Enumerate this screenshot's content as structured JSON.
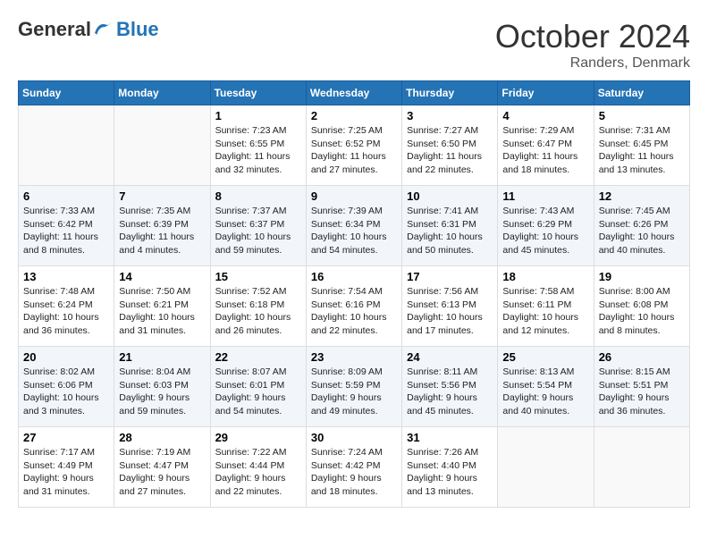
{
  "logo": {
    "general": "General",
    "blue": "Blue"
  },
  "header": {
    "month": "October 2024",
    "location": "Randers, Denmark"
  },
  "weekdays": [
    "Sunday",
    "Monday",
    "Tuesday",
    "Wednesday",
    "Thursday",
    "Friday",
    "Saturday"
  ],
  "weeks": [
    [
      {
        "day": "",
        "empty": true
      },
      {
        "day": "",
        "empty": true
      },
      {
        "day": "1",
        "line1": "Sunrise: 7:23 AM",
        "line2": "Sunset: 6:55 PM",
        "line3": "Daylight: 11 hours",
        "line4": "and 32 minutes."
      },
      {
        "day": "2",
        "line1": "Sunrise: 7:25 AM",
        "line2": "Sunset: 6:52 PM",
        "line3": "Daylight: 11 hours",
        "line4": "and 27 minutes."
      },
      {
        "day": "3",
        "line1": "Sunrise: 7:27 AM",
        "line2": "Sunset: 6:50 PM",
        "line3": "Daylight: 11 hours",
        "line4": "and 22 minutes."
      },
      {
        "day": "4",
        "line1": "Sunrise: 7:29 AM",
        "line2": "Sunset: 6:47 PM",
        "line3": "Daylight: 11 hours",
        "line4": "and 18 minutes."
      },
      {
        "day": "5",
        "line1": "Sunrise: 7:31 AM",
        "line2": "Sunset: 6:45 PM",
        "line3": "Daylight: 11 hours",
        "line4": "and 13 minutes."
      }
    ],
    [
      {
        "day": "6",
        "line1": "Sunrise: 7:33 AM",
        "line2": "Sunset: 6:42 PM",
        "line3": "Daylight: 11 hours",
        "line4": "and 8 minutes."
      },
      {
        "day": "7",
        "line1": "Sunrise: 7:35 AM",
        "line2": "Sunset: 6:39 PM",
        "line3": "Daylight: 11 hours",
        "line4": "and 4 minutes."
      },
      {
        "day": "8",
        "line1": "Sunrise: 7:37 AM",
        "line2": "Sunset: 6:37 PM",
        "line3": "Daylight: 10 hours",
        "line4": "and 59 minutes."
      },
      {
        "day": "9",
        "line1": "Sunrise: 7:39 AM",
        "line2": "Sunset: 6:34 PM",
        "line3": "Daylight: 10 hours",
        "line4": "and 54 minutes."
      },
      {
        "day": "10",
        "line1": "Sunrise: 7:41 AM",
        "line2": "Sunset: 6:31 PM",
        "line3": "Daylight: 10 hours",
        "line4": "and 50 minutes."
      },
      {
        "day": "11",
        "line1": "Sunrise: 7:43 AM",
        "line2": "Sunset: 6:29 PM",
        "line3": "Daylight: 10 hours",
        "line4": "and 45 minutes."
      },
      {
        "day": "12",
        "line1": "Sunrise: 7:45 AM",
        "line2": "Sunset: 6:26 PM",
        "line3": "Daylight: 10 hours",
        "line4": "and 40 minutes."
      }
    ],
    [
      {
        "day": "13",
        "line1": "Sunrise: 7:48 AM",
        "line2": "Sunset: 6:24 PM",
        "line3": "Daylight: 10 hours",
        "line4": "and 36 minutes."
      },
      {
        "day": "14",
        "line1": "Sunrise: 7:50 AM",
        "line2": "Sunset: 6:21 PM",
        "line3": "Daylight: 10 hours",
        "line4": "and 31 minutes."
      },
      {
        "day": "15",
        "line1": "Sunrise: 7:52 AM",
        "line2": "Sunset: 6:18 PM",
        "line3": "Daylight: 10 hours",
        "line4": "and 26 minutes."
      },
      {
        "day": "16",
        "line1": "Sunrise: 7:54 AM",
        "line2": "Sunset: 6:16 PM",
        "line3": "Daylight: 10 hours",
        "line4": "and 22 minutes."
      },
      {
        "day": "17",
        "line1": "Sunrise: 7:56 AM",
        "line2": "Sunset: 6:13 PM",
        "line3": "Daylight: 10 hours",
        "line4": "and 17 minutes."
      },
      {
        "day": "18",
        "line1": "Sunrise: 7:58 AM",
        "line2": "Sunset: 6:11 PM",
        "line3": "Daylight: 10 hours",
        "line4": "and 12 minutes."
      },
      {
        "day": "19",
        "line1": "Sunrise: 8:00 AM",
        "line2": "Sunset: 6:08 PM",
        "line3": "Daylight: 10 hours",
        "line4": "and 8 minutes."
      }
    ],
    [
      {
        "day": "20",
        "line1": "Sunrise: 8:02 AM",
        "line2": "Sunset: 6:06 PM",
        "line3": "Daylight: 10 hours",
        "line4": "and 3 minutes."
      },
      {
        "day": "21",
        "line1": "Sunrise: 8:04 AM",
        "line2": "Sunset: 6:03 PM",
        "line3": "Daylight: 9 hours",
        "line4": "and 59 minutes."
      },
      {
        "day": "22",
        "line1": "Sunrise: 8:07 AM",
        "line2": "Sunset: 6:01 PM",
        "line3": "Daylight: 9 hours",
        "line4": "and 54 minutes."
      },
      {
        "day": "23",
        "line1": "Sunrise: 8:09 AM",
        "line2": "Sunset: 5:59 PM",
        "line3": "Daylight: 9 hours",
        "line4": "and 49 minutes."
      },
      {
        "day": "24",
        "line1": "Sunrise: 8:11 AM",
        "line2": "Sunset: 5:56 PM",
        "line3": "Daylight: 9 hours",
        "line4": "and 45 minutes."
      },
      {
        "day": "25",
        "line1": "Sunrise: 8:13 AM",
        "line2": "Sunset: 5:54 PM",
        "line3": "Daylight: 9 hours",
        "line4": "and 40 minutes."
      },
      {
        "day": "26",
        "line1": "Sunrise: 8:15 AM",
        "line2": "Sunset: 5:51 PM",
        "line3": "Daylight: 9 hours",
        "line4": "and 36 minutes."
      }
    ],
    [
      {
        "day": "27",
        "line1": "Sunrise: 7:17 AM",
        "line2": "Sunset: 4:49 PM",
        "line3": "Daylight: 9 hours",
        "line4": "and 31 minutes."
      },
      {
        "day": "28",
        "line1": "Sunrise: 7:19 AM",
        "line2": "Sunset: 4:47 PM",
        "line3": "Daylight: 9 hours",
        "line4": "and 27 minutes."
      },
      {
        "day": "29",
        "line1": "Sunrise: 7:22 AM",
        "line2": "Sunset: 4:44 PM",
        "line3": "Daylight: 9 hours",
        "line4": "and 22 minutes."
      },
      {
        "day": "30",
        "line1": "Sunrise: 7:24 AM",
        "line2": "Sunset: 4:42 PM",
        "line3": "Daylight: 9 hours",
        "line4": "and 18 minutes."
      },
      {
        "day": "31",
        "line1": "Sunrise: 7:26 AM",
        "line2": "Sunset: 4:40 PM",
        "line3": "Daylight: 9 hours",
        "line4": "and 13 minutes."
      },
      {
        "day": "",
        "empty": true
      },
      {
        "day": "",
        "empty": true
      }
    ]
  ]
}
